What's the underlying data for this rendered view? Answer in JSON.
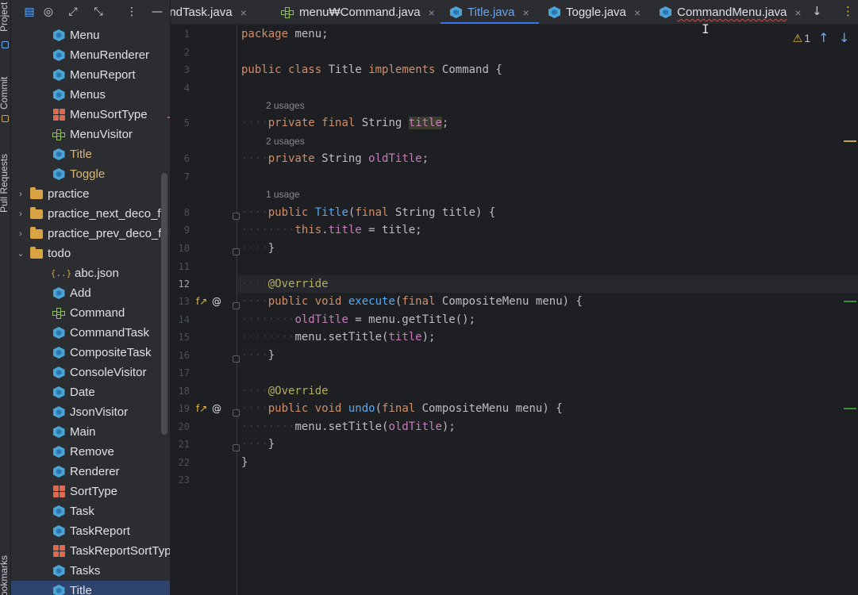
{
  "toolstrip": {
    "project_label": "Project",
    "commit_label": "Commit",
    "pull_requests_label": "Pull Requests",
    "bookmarks_label": "Bookmarks"
  },
  "tree": {
    "items": [
      {
        "label": "Menu",
        "icon": "class",
        "indent": 52
      },
      {
        "label": "MenuRenderer",
        "icon": "class",
        "indent": 52
      },
      {
        "label": "MenuReport",
        "icon": "class",
        "indent": 52
      },
      {
        "label": "Menus",
        "icon": "class",
        "indent": 52
      },
      {
        "label": "MenuSortType",
        "icon": "enum",
        "indent": 52
      },
      {
        "label": "MenuVisitor",
        "icon": "interface",
        "indent": 52
      },
      {
        "label": "Title",
        "icon": "class",
        "indent": 52,
        "yellow": true
      },
      {
        "label": "Toggle",
        "icon": "class",
        "indent": 52,
        "yellow": true
      },
      {
        "label": "practice",
        "icon": "folder",
        "indent": 30,
        "arrow": "›"
      },
      {
        "label": "practice_next_deco_fo",
        "icon": "folder",
        "indent": 30,
        "arrow": "›"
      },
      {
        "label": "practice_prev_deco_fo",
        "icon": "folder",
        "indent": 30,
        "arrow": "›"
      },
      {
        "label": "todo",
        "icon": "folder",
        "indent": 30,
        "arrow": "⌄"
      },
      {
        "label": "abc.json",
        "icon": "json",
        "indent": 52
      },
      {
        "label": "Add",
        "icon": "class",
        "indent": 52
      },
      {
        "label": "Command",
        "icon": "interface",
        "indent": 52
      },
      {
        "label": "CommandTask",
        "icon": "class",
        "indent": 52
      },
      {
        "label": "CompositeTask",
        "icon": "class",
        "indent": 52
      },
      {
        "label": "ConsoleVisitor",
        "icon": "class",
        "indent": 52
      },
      {
        "label": "Date",
        "icon": "class",
        "indent": 52
      },
      {
        "label": "JsonVisitor",
        "icon": "class",
        "indent": 52
      },
      {
        "label": "Main",
        "icon": "main",
        "indent": 52
      },
      {
        "label": "Remove",
        "icon": "class",
        "indent": 52
      },
      {
        "label": "Renderer",
        "icon": "class",
        "indent": 52
      },
      {
        "label": "SortType",
        "icon": "enum",
        "indent": 52
      },
      {
        "label": "Task",
        "icon": "class",
        "indent": 52
      },
      {
        "label": "TaskReport",
        "icon": "class",
        "indent": 52
      },
      {
        "label": "TaskReportSortTyp",
        "icon": "enum",
        "indent": 52
      },
      {
        "label": "Tasks",
        "icon": "class",
        "indent": 52
      },
      {
        "label": "Title",
        "icon": "class",
        "indent": 52,
        "selected": true
      }
    ]
  },
  "tabs": [
    {
      "label": "andTask.java",
      "icon": "none",
      "active": false,
      "close": "×"
    },
    {
      "label": "menu₩Command.java",
      "icon": "interface",
      "active": false,
      "close": "×"
    },
    {
      "label": "Title.java",
      "icon": "class",
      "active": true,
      "close": "×"
    },
    {
      "label": "Toggle.java",
      "icon": "class",
      "active": false,
      "close": "×"
    },
    {
      "label": "CommandMenu.java",
      "icon": "class",
      "active": false,
      "close": "×",
      "error": true
    }
  ],
  "editor": {
    "warning_count": "1",
    "current_line": 12,
    "line_numbers": [
      "1",
      "2",
      "3",
      "4",
      "5",
      "6",
      "7",
      "8",
      "9",
      "10",
      "11",
      "12",
      "13",
      "14",
      "15",
      "16",
      "17",
      "18",
      "19",
      "20",
      "21",
      "22",
      "23"
    ],
    "hints": {
      "usages_2a": "2 usages",
      "usages_2b": "2 usages",
      "usages_1": "1 usage"
    },
    "code": {
      "l1_kw": "package",
      "l1_rest": " menu;",
      "l3_kw1": "public",
      "l3_kw2": "class",
      "l3_name": " Title ",
      "l3_kw3": "implements",
      "l3_rest": " Command {",
      "l5_kw1": "private",
      "l5_kw2": "final",
      "l5_type": " String ",
      "l5_field": "title",
      "l5_end": ";",
      "l6_kw1": "private",
      "l6_type": " String ",
      "l6_field": "oldTitle",
      "l6_end": ";",
      "l8_kw1": "public",
      "l8_fn": " Title",
      "l8_open": "(",
      "l8_kw2": "final",
      "l8_rest": " String title) {",
      "l9_kw": "this",
      "l9_dot": ".",
      "l9_field": "title",
      "l9_rest": " = title;",
      "l10": "}",
      "l12_an": "@Override",
      "l13_kw1": "public",
      "l13_kw2": "void",
      "l13_fn": " execute",
      "l13_open": "(",
      "l13_kw3": "final",
      "l13_rest": " CompositeMenu menu) {",
      "l14_field": "oldTitle",
      "l14_rest": " = menu.getTitle();",
      "l15_pre": "menu.setTitle(",
      "l15_field": "title",
      "l15_end": ");",
      "l16": "}",
      "l18_an": "@Override",
      "l19_kw1": "public",
      "l19_kw2": "void",
      "l19_fn": " undo",
      "l19_open": "(",
      "l19_kw3": "final",
      "l19_rest": " CompositeMenu menu) {",
      "l20_pre": "menu.setTitle(",
      "l20_field": "oldTitle",
      "l20_end": ");",
      "l21": "}",
      "l22": "}"
    }
  },
  "colors": {
    "accent": "#3574f0",
    "keyword": "#cf8e6d",
    "field": "#c77dbb",
    "function": "#56a8f5",
    "annotation": "#b3ae60",
    "warning": "#e5b84a"
  }
}
